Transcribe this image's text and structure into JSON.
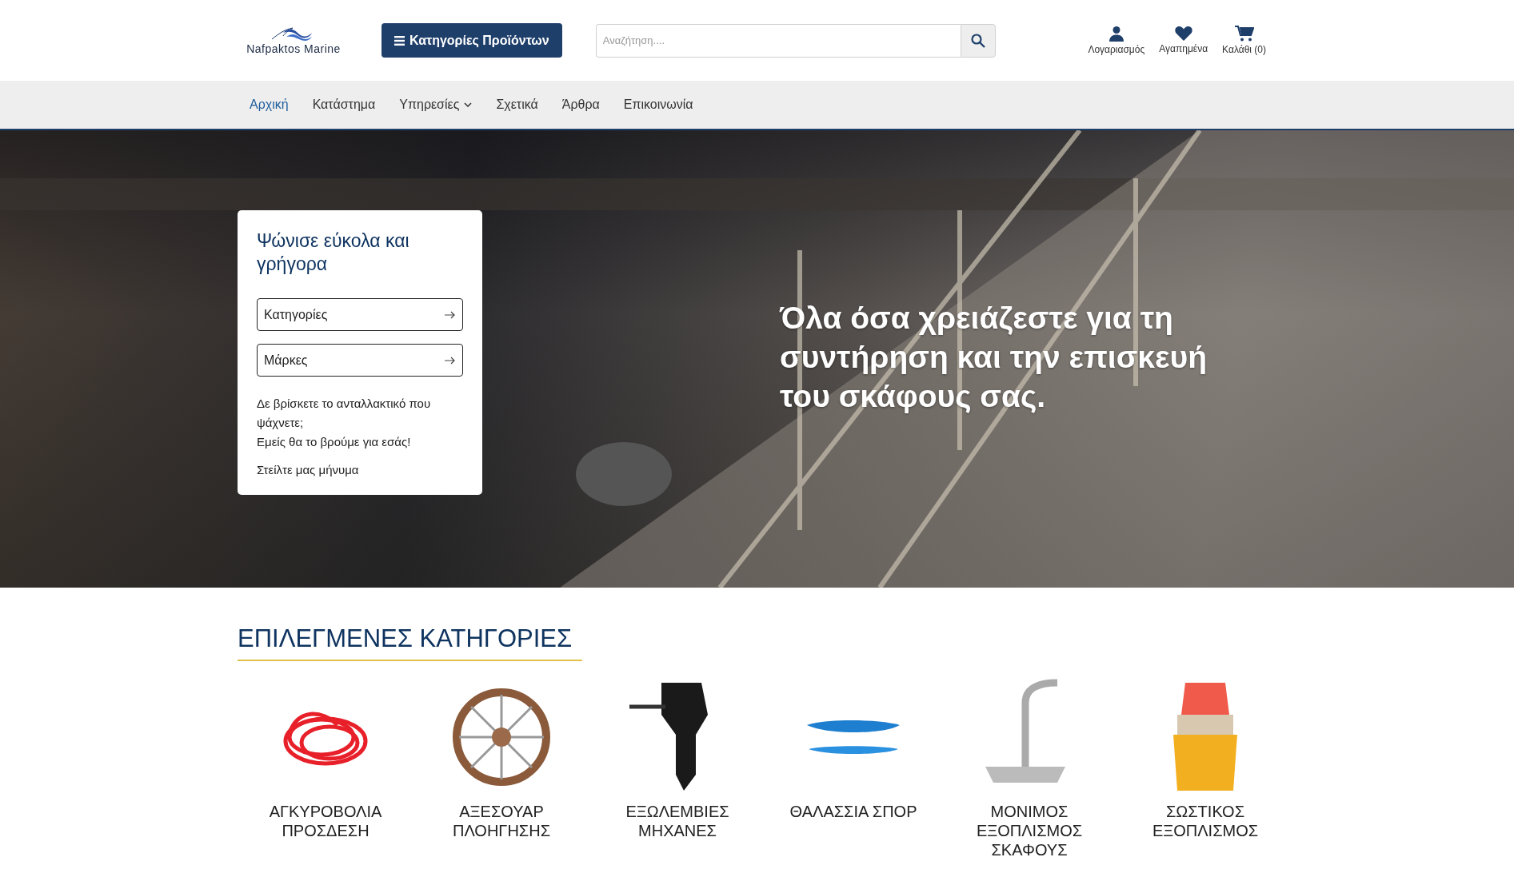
{
  "header": {
    "logo": "Nafpaktos Marine",
    "categories_button": "Κατηγορίες Προϊόντων",
    "search": {
      "placeholder": "Αναζήτηση...."
    },
    "actions": [
      {
        "kind": "account",
        "label": "Λογαριασμός"
      },
      {
        "kind": "wishlist",
        "label": "Αγαπημένα"
      },
      {
        "kind": "cart",
        "label": "Καλάθι (0)"
      }
    ]
  },
  "nav": [
    {
      "label": "Αρχική",
      "selected": true,
      "has_menu": false
    },
    {
      "label": "Κατάστημα",
      "selected": false,
      "has_menu": false
    },
    {
      "label": "Υπηρεσίες",
      "selected": false,
      "has_menu": true
    },
    {
      "label": "Σχετικά",
      "selected": false,
      "has_menu": false
    },
    {
      "label": "Άρθρα",
      "selected": false,
      "has_menu": false
    },
    {
      "label": "Επικοινωνία",
      "selected": false,
      "has_menu": false
    }
  ],
  "hero": {
    "card_title": "Ψώνισε εύκολα και γρήγορα",
    "links": [
      "Κατηγορίες",
      "Μάρκες"
    ],
    "help_lines": [
      "Δε βρίσκετε το ανταλλακτικό που ψάχνετε;",
      "Εμείς θα το βρούμε για εσάς!"
    ],
    "contact_link": "Στείλτε μας μήνυμα",
    "headline": "Όλα όσα χρειάζεστε για τη συντήρηση και την επισκευή του σκάφους σας."
  },
  "featured": {
    "title": "ΕΠΙΛΕΓΜΕΝΕΣ ΚΑΤΗΓΟΡΙΕΣ",
    "categories": [
      {
        "kind": "rope",
        "label": "ΑΓΚΥΡΟΒΟΛΙΑ ΠΡΟΣΔΕΣΗ"
      },
      {
        "kind": "wheel",
        "label": "ΑΞΕΣΟΥΑΡ ΠΛΟΗΓΗΣΗΣ"
      },
      {
        "kind": "engine",
        "label": "ΕΞΩΛΕΜΒΙΕΣ ΜΗΧΑΝΕΣ"
      },
      {
        "kind": "kayak",
        "label": "ΘΑΛΑΣΣΙΑ ΣΠΟΡ"
      },
      {
        "kind": "faucet",
        "label": "ΜΟΝΙΜΟΣ ΕΞΟΠΛΙΣΜΟΣ ΣΚΑΦΟΥΣ"
      },
      {
        "kind": "lifejacket",
        "label": "ΣΩΣΤΙΚΟΣ ΕΞΟΠΛΙΣΜΟΣ"
      }
    ]
  }
}
